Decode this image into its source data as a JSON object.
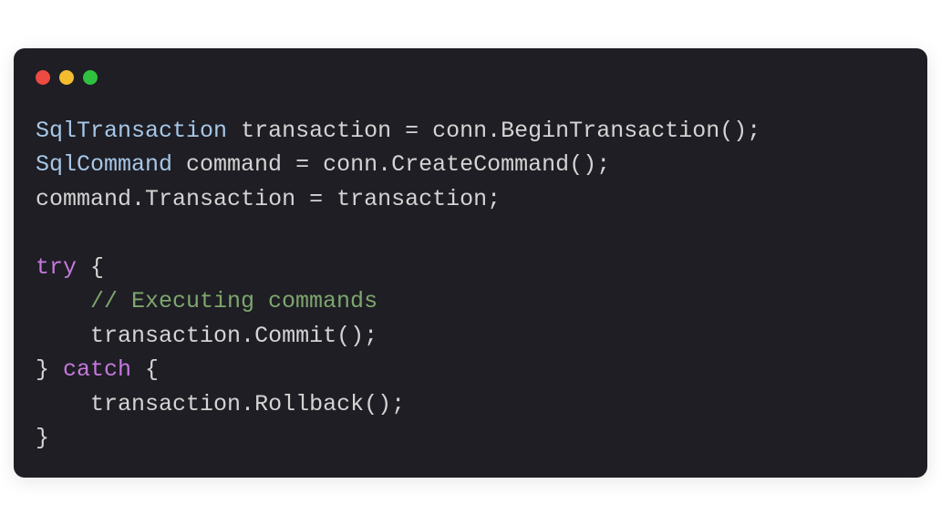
{
  "window": {
    "traffic_lights": {
      "red": "#ec4a42",
      "yellow": "#f4bd2f",
      "green": "#2fc140"
    }
  },
  "code": {
    "line1": {
      "type": "SqlTransaction",
      "variable": "transaction",
      "equals": "=",
      "object": "conn",
      "dot": ".",
      "method": "BeginTransaction",
      "parens": "();"
    },
    "line2": {
      "type": "SqlCommand",
      "variable": "command",
      "equals": "=",
      "object": "conn",
      "dot": ".",
      "method": "CreateCommand",
      "parens": "();"
    },
    "line3": {
      "object": "command",
      "dot": ".",
      "property": "Transaction",
      "equals": "=",
      "value": "transaction",
      "semi": ";"
    },
    "line5": {
      "keyword": "try",
      "brace": " {"
    },
    "line6": {
      "indent": "    ",
      "comment": "// Executing commands"
    },
    "line7": {
      "indent": "    ",
      "object": "transaction",
      "dot": ".",
      "method": "Commit",
      "parens": "();"
    },
    "line8": {
      "close": "}",
      "keyword": " catch ",
      "brace": "{"
    },
    "line9": {
      "indent": "    ",
      "object": "transaction",
      "dot": ".",
      "method": "Rollback",
      "parens": "();"
    },
    "line10": {
      "close": "}"
    }
  }
}
